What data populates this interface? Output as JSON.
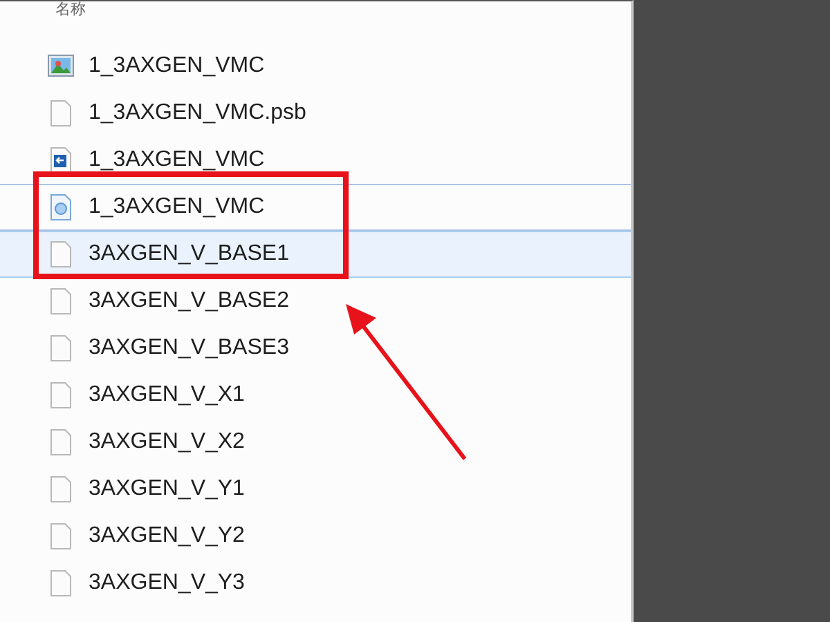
{
  "column_header": "名称",
  "files": [
    {
      "name": "1_3AXGEN_VMC",
      "kind": "image",
      "selected": false,
      "focused": false
    },
    {
      "name": "1_3AXGEN_VMC.psb",
      "kind": "blank",
      "selected": false,
      "focused": false
    },
    {
      "name": "1_3AXGEN_VMC",
      "kind": "shortcut",
      "selected": false,
      "focused": false
    },
    {
      "name": "1_3AXGEN_VMC",
      "kind": "web",
      "selected": false,
      "focused": true
    },
    {
      "name": "3AXGEN_V_BASE1",
      "kind": "blank",
      "selected": true,
      "focused": false
    },
    {
      "name": "3AXGEN_V_BASE2",
      "kind": "blank",
      "selected": false,
      "focused": false
    },
    {
      "name": "3AXGEN_V_BASE3",
      "kind": "blank",
      "selected": false,
      "focused": false
    },
    {
      "name": "3AXGEN_V_X1",
      "kind": "blank",
      "selected": false,
      "focused": false
    },
    {
      "name": "3AXGEN_V_X2",
      "kind": "blank",
      "selected": false,
      "focused": false
    },
    {
      "name": "3AXGEN_V_Y1",
      "kind": "blank",
      "selected": false,
      "focused": false
    },
    {
      "name": "3AXGEN_V_Y2",
      "kind": "blank",
      "selected": false,
      "focused": false
    },
    {
      "name": "3AXGEN_V_Y3",
      "kind": "blank",
      "selected": false,
      "focused": false
    }
  ]
}
